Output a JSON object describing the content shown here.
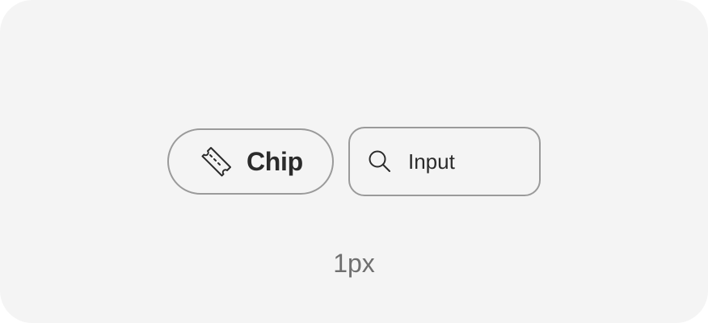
{
  "chip": {
    "icon": "ticket-icon",
    "label": "Chip"
  },
  "input": {
    "icon": "search-icon",
    "value": "Input"
  },
  "caption": "1px",
  "colors": {
    "background": "#f4f4f4",
    "border": "#9a9a9a",
    "text": "#2b2b2b",
    "caption": "#6f6f6f"
  }
}
